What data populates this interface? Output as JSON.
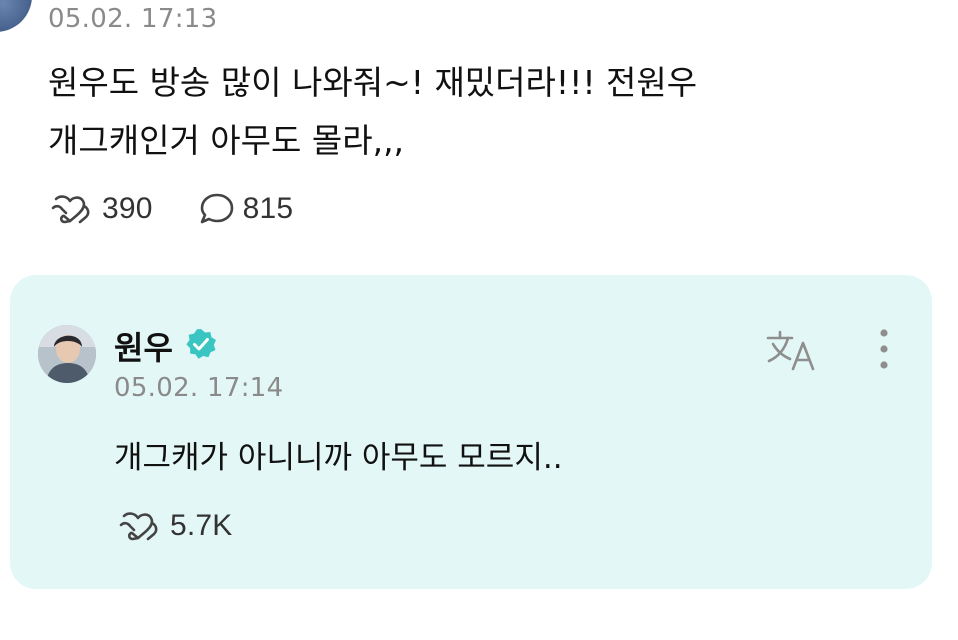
{
  "fan_post": {
    "timestamp": "05.02. 17:13",
    "text_lines": [
      "원우도 방송 많이 나와줘~! 재밌더라!!! 전원우",
      "개그캐인거 아무도 몰라,,,"
    ],
    "like_count": "390",
    "comment_count": "815"
  },
  "artist_reply": {
    "name": "원우",
    "verified": true,
    "timestamp": "05.02. 17:14",
    "text": "개그캐가 아니니까 아무도 모르지..",
    "like_count": "5.7K"
  },
  "icons": {
    "like": "heart-hands-outline-icon",
    "comment": "speech-bubble-icon",
    "verified": "verified-badge-icon",
    "translate": "translate-icon",
    "more": "more-vertical-icon"
  },
  "colors": {
    "reply_card_bg": "#e3f8f6",
    "verified_badge": "#39c6c2",
    "timestamp": "#8a8a8a"
  }
}
